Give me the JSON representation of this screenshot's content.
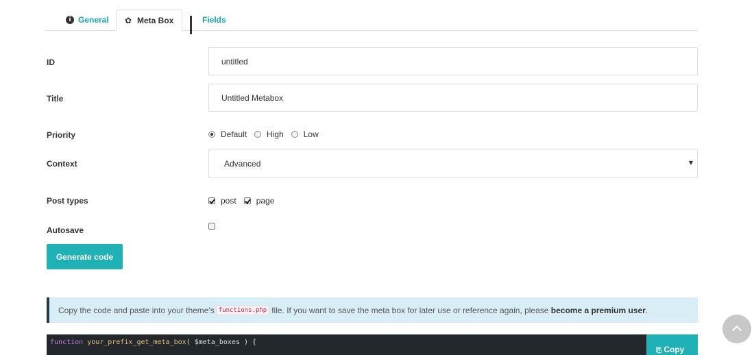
{
  "tabs": [
    {
      "label": "General",
      "icon": "info-icon",
      "active": false
    },
    {
      "label": "Meta Box",
      "icon": "gear-icon",
      "active": true
    },
    {
      "label": "Fields",
      "icon": "grid-icon",
      "active": false
    }
  ],
  "form": {
    "id_label": "ID",
    "id_value": "untitled",
    "title_label": "Title",
    "title_value": "Untitled Metabox",
    "priority_label": "Priority",
    "priority_options": [
      "Default",
      "High",
      "Low"
    ],
    "priority_selected": "Default",
    "context_label": "Context",
    "context_value": "Advanced",
    "post_types_label": "Post types",
    "post_types": [
      {
        "label": "post",
        "checked": true
      },
      {
        "label": "page",
        "checked": true
      }
    ],
    "autosave_label": "Autosave",
    "autosave_checked": false
  },
  "generate_button": "Generate code",
  "notice": {
    "text_before": "Copy the code and paste into your theme's",
    "code": "functions.php",
    "text_after": "file. If you want to save the meta box for later use or reference again, please",
    "link": "become a premium user",
    "end": "."
  },
  "code": {
    "keyword": "function",
    "function_name": "your_prefix_get_meta_box",
    "rest": "( $meta_boxes ) {"
  },
  "copy_button": "Copy",
  "colors": {
    "accent": "#1fb1b5",
    "notice_bg": "#d9edf7",
    "code_bg": "#23282d"
  }
}
